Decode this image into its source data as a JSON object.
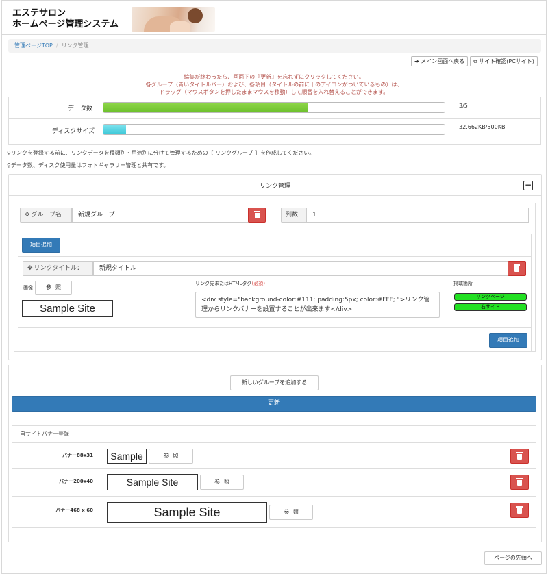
{
  "app": {
    "title_line1": "エステサロン",
    "title_line2": "ホームページ管理システム"
  },
  "breadcrumb": {
    "home": "管理ページTOP",
    "separator": "/",
    "current": "リンク管理"
  },
  "toolbar": {
    "back_main": "メイン画面へ戻る",
    "site_check": "サイト確認(PCサイト)"
  },
  "notice": {
    "line1": "編集が終わったら、画面下の『更新』を忘れずにクリックしてください。",
    "line2": "各グループ（青いタイトルバー）および、各項目（タイトルの前に十のアイコンがついているもの）は、",
    "line3": "ドラッグ（マウスボタンを押したままマウスを移動）して順番を入れ替えることができます。"
  },
  "stats": {
    "data_count": {
      "label": "データ数",
      "value_text": "3/5",
      "fill_fraction": 0.6,
      "color": "#6cc02c"
    },
    "disk_size": {
      "label": "ディスクサイズ",
      "value_text": "32.662KB/500KB",
      "fill_fraction": 0.0653,
      "color": "#3cc8d8"
    }
  },
  "notes": {
    "note1": "リンクを登録する前に、リンクデータを種類別・用途別に分けて管理するための【 リンクグループ 】を作成してください。",
    "note2": "データ数、ディスク使用量はフォトギャラリー管理と共有です。"
  },
  "panel": {
    "title": "リンク管理",
    "group": {
      "name_label": "グループ名",
      "name_value": "新規グループ",
      "columns_label": "列数",
      "columns_value": "1",
      "add_item_label": "項目追加",
      "item": {
        "title_label": "リンクタイトル：",
        "title_value": "新規タイトル",
        "image_label": "画像",
        "browse_label": "参照",
        "sample_text": "Sample Site",
        "html_label": "リンク先またはHTMLタグ",
        "html_required": "(必須)",
        "html_value": "<div style=\"background-color:#111; padding:5px; color:#FFF; \">リンク管理からリンクバナーを設置することが出来ます</div>",
        "placement_label": "掲載箇所",
        "placement_options": [
          "リンクページ",
          "右サイド"
        ]
      },
      "add_item_bottom_label": "項目追加"
    },
    "new_group_label": "新しいグループを追加する",
    "update_label": "更新"
  },
  "banners": {
    "title": "自サイトバナー登録",
    "items": [
      {
        "label": "バナー88x31",
        "sample": "Sample",
        "browse": "参照"
      },
      {
        "label": "バナー200x40",
        "sample": "Sample Site",
        "browse": "参照"
      },
      {
        "label": "バナー468 x 60",
        "sample": "Sample Site",
        "browse": "参照"
      }
    ]
  },
  "footer": {
    "to_top_label": "ページの先頭へ"
  },
  "colors": {
    "primary": "#337ab7",
    "danger": "#d9534f",
    "notice": "#b5544e",
    "pill": "#22e022"
  }
}
